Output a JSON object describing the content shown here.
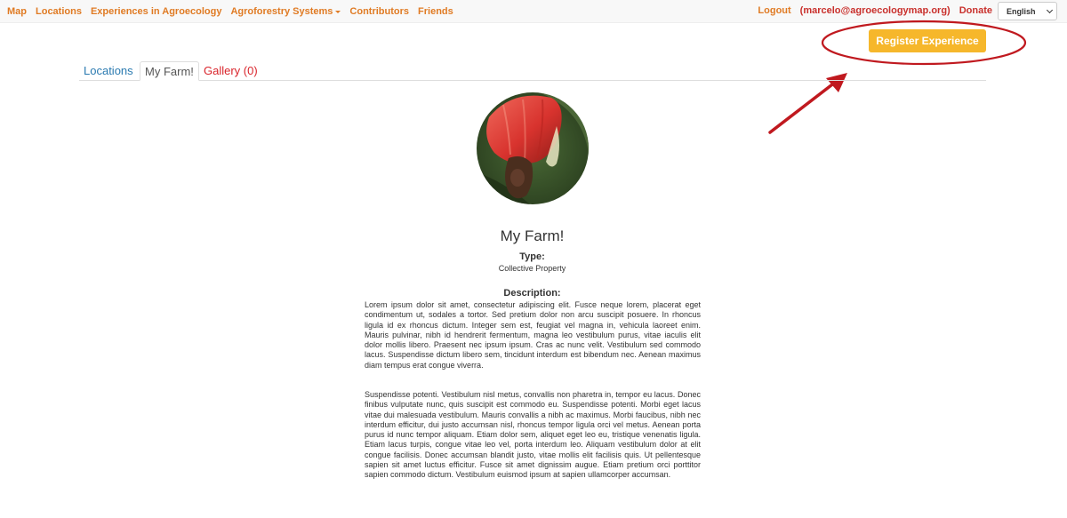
{
  "navbar": {
    "links": {
      "map": "Map",
      "locations": "Locations",
      "experiences": "Experiences in Agroecology",
      "agroforestry": "Agroforestry Systems",
      "contributors": "Contributors",
      "friends": "Friends"
    },
    "logout": "Logout",
    "user_email": "(marcelo@agroecologymap.org)",
    "donate": "Donate",
    "language": "English"
  },
  "register_button": "Register Experience",
  "tabs": {
    "locations": "Locations",
    "my_farm": "My Farm!",
    "gallery": "Gallery (0)"
  },
  "farm": {
    "title": "My Farm!",
    "type_label": "Type:",
    "type_value": "Collective Property",
    "description_label": "Description:",
    "description_p1": "Lorem ipsum dolor sit amet, consectetur adipiscing elit. Fusce neque lorem, placerat eget condimentum ut, sodales a tortor. Sed pretium dolor non arcu suscipit posuere. In rhoncus ligula id ex rhoncus dictum. Integer sem est, feugiat vel magna in, vehicula laoreet enim. Mauris pulvinar, nibh id hendrerit fermentum, magna leo vestibulum purus, vitae iaculis elit dolor mollis libero. Praesent nec ipsum ipsum. Cras ac nunc velit. Vestibulum sed commodo lacus. Suspendisse dictum libero sem, tincidunt interdum est bibendum nec. Aenean maximus diam tempus erat congue viverra.",
    "description_p2": "Suspendisse potenti. Vestibulum nisl metus, convallis non pharetra in, tempor eu lacus. Donec finibus vulputate nunc, quis suscipit est commodo eu. Suspendisse potenti. Morbi eget lacus vitae dui malesuada vestibulum. Mauris convallis a nibh ac maximus. Morbi faucibus, nibh nec interdum efficitur, dui justo accumsan nisl, rhoncus tempor ligula orci vel metus. Aenean porta purus id nunc tempor aliquam. Etiam dolor sem, aliquet eget leo eu, tristique venenatis ligula. Etiam lacus turpis, congue vitae leo vel, porta interdum leo. Aliquam vestibulum dolor at elit congue facilisis. Donec accumsan blandit justo, vitae mollis elit facilisis quis. Ut pellentesque sapien sit amet luctus efficitur. Fusce sit amet dignissim augue. Etiam pretium orci porttitor sapien commodo dictum. Vestibulum euismod ipsum at sapien ullamcorper accumsan."
  },
  "colors": {
    "nav_link": "#e07b24",
    "nav_accent": "#c9302c",
    "register_button": "#f6b72b",
    "annotation": "#c0191f",
    "tab_link": "#2a7ab0"
  },
  "icons": {
    "dropdown_caret": "caret-down-icon",
    "select_chevron": "chevron-down-icon",
    "annotation_arrow": "arrow-icon"
  }
}
